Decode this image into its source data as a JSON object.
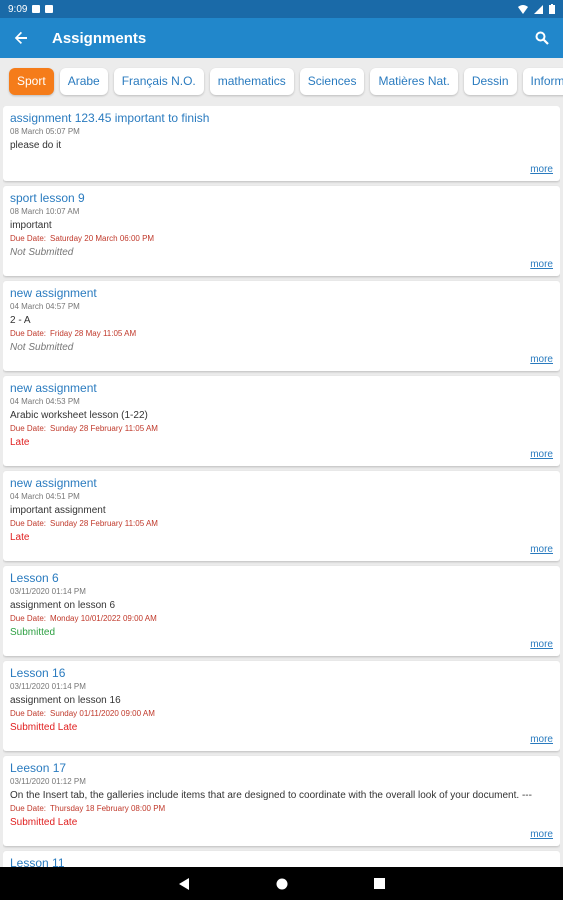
{
  "statusbar": {
    "time": "9:09"
  },
  "appbar": {
    "title": "Assignments"
  },
  "tabs": [
    "Sport",
    "Arabe",
    "Français N.O.",
    "mathematics",
    "Sciences",
    "Matières Nat.",
    "Dessin",
    "Informatique"
  ],
  "assignments": [
    {
      "title": "assignment 123.45 important to finish",
      "date": "08 March   05:07 PM",
      "desc": "please do it",
      "due_label": "",
      "due": "",
      "status": "",
      "more": "more"
    },
    {
      "title": "sport lesson 9",
      "date": "08 March   10:07 AM",
      "desc": "important",
      "due_label": "Due Date:",
      "due": "Saturday 20 March 06:00 PM",
      "status": "Not Submitted",
      "more": "more"
    },
    {
      "title": "new assignment",
      "date": "04 March   04:57 PM",
      "desc": "2 - A",
      "due_label": "Due Date:",
      "due": "Friday 28 May 11:05 AM",
      "status": "Not Submitted",
      "more": "more"
    },
    {
      "title": "new assignment",
      "date": "04 March   04:53 PM",
      "desc": "Arabic worksheet lesson (1-22)",
      "due_label": "Due Date:",
      "due": "Sunday 28 February 11:05 AM",
      "status": "Late",
      "more": "more"
    },
    {
      "title": "new assignment",
      "date": "04 March   04:51 PM",
      "desc": "important  assignment",
      "due_label": "Due Date:",
      "due": "Sunday 28 February 11:05 AM",
      "status": "Late",
      "more": "more"
    },
    {
      "title": "Lesson 6",
      "date": "03/11/2020  01:14 PM",
      "desc": "assignment on lesson 6",
      "due_label": "Due Date:",
      "due": "Monday 10/01/2022 09:00 AM",
      "status": "Submitted",
      "more": "more"
    },
    {
      "title": "Lesson 16",
      "date": "03/11/2020  01:14 PM",
      "desc": "assignment on lesson 16",
      "due_label": "Due Date:",
      "due": "Sunday 01/11/2020 09:00 AM",
      "status": "Submitted Late",
      "more": "more"
    },
    {
      "title": "Leeson 17",
      "date": "03/11/2020  01:12 PM",
      "desc": "On the Insert tab, the galleries include items that are designed to coordinate with the overall look of your document. ---",
      "due_label": "Due Date:",
      "due": "Thursday 18 February 08:00 PM",
      "status": "Submitted Late",
      "more": "more"
    },
    {
      "title": "Lesson 11",
      "date": "",
      "desc": "",
      "due_label": "",
      "due": "",
      "status": "",
      "more": ""
    }
  ],
  "colors": {
    "appbar": "#2187cb",
    "statusbar": "#1a6aa8",
    "active_tab": "#f57c1a",
    "link": "#2a7bbf",
    "late": "#e02020",
    "submitted": "#2ea043"
  }
}
